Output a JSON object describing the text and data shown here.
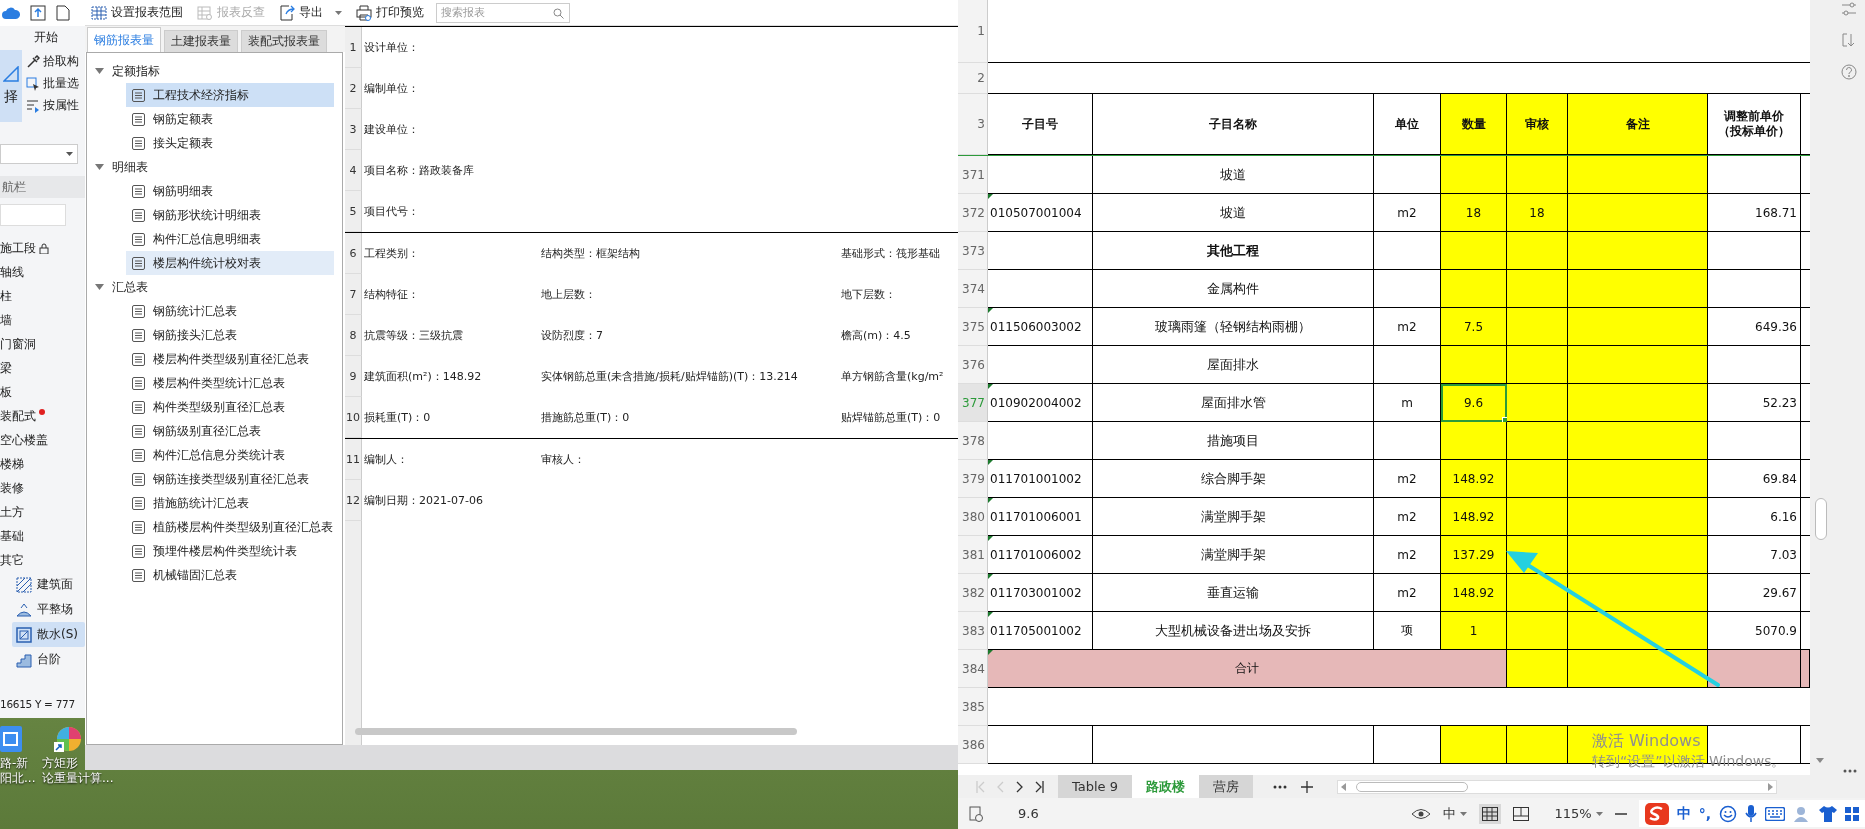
{
  "app": {
    "ribbon_tab": "开始",
    "select_button": "择",
    "tools": [
      {
        "label": "拾取构",
        "kind": "pick"
      },
      {
        "label": "批量选",
        "kind": "batch"
      },
      {
        "label": "按属性",
        "kind": "attr"
      }
    ],
    "panel_title": "航栏",
    "nav_items": [
      {
        "label": "施工段",
        "locked": true,
        "notified": false
      },
      {
        "label": "轴线",
        "locked": false,
        "notified": false
      },
      {
        "label": "柱",
        "locked": false,
        "notified": false
      },
      {
        "label": "墙",
        "locked": false,
        "notified": false
      },
      {
        "label": "门窗洞",
        "locked": false,
        "notified": false
      },
      {
        "label": "梁",
        "locked": false,
        "notified": false
      },
      {
        "label": "板",
        "locked": false,
        "notified": false
      },
      {
        "label": "装配式",
        "locked": false,
        "notified": true
      },
      {
        "label": "空心楼盖",
        "locked": false,
        "notified": false
      },
      {
        "label": "楼梯",
        "locked": false,
        "notified": false
      },
      {
        "label": "装修",
        "locked": false,
        "notified": false
      },
      {
        "label": "土方",
        "locked": false,
        "notified": false
      },
      {
        "label": "基础",
        "locked": false,
        "notified": false
      },
      {
        "label": "其它",
        "locked": false,
        "notified": false,
        "children": [
          {
            "label": "建筑面",
            "kind": "area",
            "selected": false
          },
          {
            "label": "平整场",
            "kind": "leveling",
            "selected": false
          },
          {
            "label": "散水(S)",
            "kind": "apron",
            "selected": true
          },
          {
            "label": "台阶",
            "kind": "steps",
            "selected": false
          }
        ]
      }
    ],
    "coordinates": "16615 Y = 777"
  },
  "desktop_icons": [
    {
      "kind": "app",
      "lines": [
        "路-新",
        "阳北..."
      ]
    },
    {
      "kind": "shortcut",
      "lines": [
        "方矩形",
        "论重量计算..."
      ]
    }
  ],
  "report": {
    "toolbar": [
      {
        "label": "设置报表范围",
        "kind": "range",
        "disabled": false,
        "dropdown": false
      },
      {
        "label": "报表反查",
        "kind": "lookup",
        "disabled": true,
        "dropdown": false
      },
      {
        "label": "导出",
        "kind": "export",
        "disabled": false,
        "dropdown": true
      },
      {
        "label": "打印预览",
        "kind": "print",
        "disabled": false,
        "dropdown": false
      }
    ],
    "search": {
      "placeholder": "搜索报表"
    },
    "tabs": [
      {
        "label": "钢筋报表量",
        "selected": true
      },
      {
        "label": "土建报表量",
        "selected": false
      },
      {
        "label": "装配式报表量",
        "selected": false
      }
    ],
    "tree": [
      {
        "label": "定额指标",
        "expanded": true,
        "children": [
          {
            "label": "工程技术经济指标",
            "selected": true,
            "hovered": false
          },
          {
            "label": "钢筋定额表",
            "selected": false,
            "hovered": false
          },
          {
            "label": "接头定额表",
            "selected": false,
            "hovered": false
          }
        ]
      },
      {
        "label": "明细表",
        "expanded": true,
        "children": [
          {
            "label": "钢筋明细表",
            "selected": false,
            "hovered": false
          },
          {
            "label": "钢筋形状统计明细表",
            "selected": false,
            "hovered": false
          },
          {
            "label": "构件汇总信息明细表",
            "selected": false,
            "hovered": false
          },
          {
            "label": "楼层构件统计校对表",
            "selected": false,
            "hovered": true
          }
        ]
      },
      {
        "label": "汇总表",
        "expanded": true,
        "children": [
          {
            "label": "钢筋统计汇总表",
            "selected": false,
            "hovered": false
          },
          {
            "label": "钢筋接头汇总表",
            "selected": false,
            "hovered": false
          },
          {
            "label": "楼层构件类型级别直径汇总表",
            "selected": false,
            "hovered": false
          },
          {
            "label": "楼层构件类型统计汇总表",
            "selected": false,
            "hovered": false
          },
          {
            "label": "构件类型级别直径汇总表",
            "selected": false,
            "hovered": false
          },
          {
            "label": "钢筋级别直径汇总表",
            "selected": false,
            "hovered": false
          },
          {
            "label": "构件汇总信息分类统计表",
            "selected": false,
            "hovered": false
          },
          {
            "label": "钢筋连接类型级别直径汇总表",
            "selected": false,
            "hovered": false
          },
          {
            "label": "措施筋统计汇总表",
            "selected": false,
            "hovered": false
          },
          {
            "label": "植筋楼层构件类型级别直径汇总表",
            "selected": false,
            "hovered": false
          },
          {
            "label": "预埋件楼层构件类型统计表",
            "selected": false,
            "hovered": false
          },
          {
            "label": "机械锚固汇总表",
            "selected": false,
            "hovered": false
          }
        ]
      }
    ],
    "sections": [
      {
        "rows": [
          {
            "num": "1",
            "cells": [
              "设计单位："
            ]
          },
          {
            "num": "2",
            "cells": [
              "编制单位："
            ]
          },
          {
            "num": "3",
            "cells": [
              "建设单位："
            ]
          },
          {
            "num": "4",
            "cells": [
              "项目名称：路政装备库"
            ]
          },
          {
            "num": "5",
            "cells": [
              "项目代号："
            ]
          }
        ]
      },
      {
        "rows": [
          {
            "num": "6",
            "cells": [
              "工程类别：",
              "结构类型：框架结构",
              "基础形式：筏形基础"
            ]
          },
          {
            "num": "7",
            "cells": [
              "结构特征：",
              "地上层数：",
              "地下层数："
            ]
          },
          {
            "num": "8",
            "cells": [
              "抗震等级：三级抗震",
              "设防烈度：7",
              "檐高(m)：4.5"
            ]
          },
          {
            "num": "9",
            "cells": [
              "建筑面积(m²)：148.92",
              "实体钢筋总重(未含措施/损耗/贴焊锚筋)(T)：13.214",
              "单方钢筋含量(kg/m²"
            ]
          },
          {
            "num": "10",
            "cells": [
              "损耗重(T)：0",
              "措施筋总重(T)：0",
              "贴焊锚筋总重(T)：0"
            ]
          }
        ]
      },
      {
        "rows": [
          {
            "num": "11",
            "cells": [
              "编制人：",
              "审核人："
            ]
          },
          {
            "num": "12",
            "cells": [
              "编制日期：2021-07-06"
            ]
          }
        ]
      }
    ]
  },
  "sheet": {
    "top_rows": [
      {
        "num": "1"
      },
      {
        "num": "2"
      }
    ],
    "header": {
      "num": "3",
      "columns": [
        {
          "label": "子目号",
          "highlighted": false
        },
        {
          "label": "子目名称",
          "highlighted": false
        },
        {
          "label": "单位",
          "highlighted": false
        },
        {
          "label": "数量",
          "highlighted": true
        },
        {
          "label": "审核",
          "highlighted": true
        },
        {
          "label": "备注",
          "highlighted": true
        },
        {
          "label": "调整前单价（投标单价）",
          "highlighted": false
        }
      ]
    },
    "rows": [
      {
        "num": "371",
        "kind": "item",
        "selected": false,
        "name": "坡道"
      },
      {
        "num": "372",
        "kind": "item",
        "selected": false,
        "code": "010507001004",
        "name": "坡道",
        "unit": "m2",
        "qty": "18",
        "check": "18",
        "price": "168.71"
      },
      {
        "num": "373",
        "kind": "heading",
        "selected": false,
        "name": "其他工程"
      },
      {
        "num": "374",
        "kind": "item",
        "selected": false,
        "name": "金属构件"
      },
      {
        "num": "375",
        "kind": "item",
        "selected": false,
        "code": "011506003002",
        "name": "玻璃雨篷（轻钢结构雨棚）",
        "unit": "m2",
        "qty": "7.5",
        "price": "649.36"
      },
      {
        "num": "376",
        "kind": "item",
        "selected": false,
        "name": "屋面排水"
      },
      {
        "num": "377",
        "kind": "item",
        "selected": true,
        "code": "010902004002",
        "name": "屋面排水管",
        "unit": "m",
        "qty": "9.6",
        "price": "52.23"
      },
      {
        "num": "378",
        "kind": "item",
        "selected": false,
        "name": "措施项目"
      },
      {
        "num": "379",
        "kind": "item",
        "selected": false,
        "code": "011701001002",
        "name": "综合脚手架",
        "unit": "m2",
        "qty": "148.92",
        "price": "69.84"
      },
      {
        "num": "380",
        "kind": "item",
        "selected": false,
        "code": "011701006001",
        "name": "满堂脚手架",
        "unit": "m2",
        "qty": "148.92",
        "price": "6.16"
      },
      {
        "num": "381",
        "kind": "item",
        "selected": false,
        "code": "011701006002",
        "name": "满堂脚手架",
        "unit": "m2",
        "qty": "137.29",
        "price": "7.03"
      },
      {
        "num": "382",
        "kind": "item",
        "selected": false,
        "code": "011703001002",
        "name": "垂直运输",
        "unit": "m2",
        "qty": "148.92",
        "price": "29.67"
      },
      {
        "num": "383",
        "kind": "item",
        "selected": false,
        "code": "011705001002",
        "name": "大型机械设备进出场及安拆",
        "unit": "项",
        "qty": "1",
        "price": "5070.9"
      },
      {
        "num": "384",
        "kind": "total",
        "selected": false,
        "name": "合计"
      },
      {
        "num": "385",
        "kind": "blank",
        "selected": false
      },
      {
        "num": "386",
        "kind": "item",
        "selected": false
      }
    ],
    "tabs": [
      {
        "label": "Table 9",
        "selected": false
      },
      {
        "label": "路政楼",
        "selected": true
      },
      {
        "label": "营房",
        "selected": false
      }
    ],
    "watermark": {
      "title": "激活 Windows",
      "subtitle": "转到“设置”以激活 Windows。"
    },
    "status": {
      "cell_value": "9.6",
      "input_mode": "中",
      "zoom": "115%"
    },
    "ime": [
      "中",
      "°,"
    ]
  }
}
